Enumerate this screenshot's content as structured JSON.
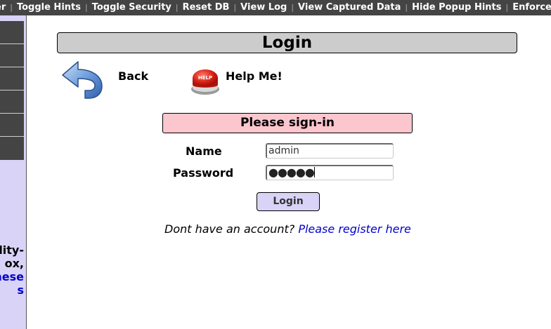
{
  "topbar": {
    "items": [
      "er",
      "Toggle Hints",
      "Toggle Security",
      "Reset DB",
      "View Log",
      "View Captured Data",
      "Hide Popup Hints",
      "Enforce SSL"
    ],
    "separator": "|"
  },
  "sidebar": {
    "blurb_line1": "lity-",
    "blurb_line2": "ox,",
    "blurb_link1": "hese",
    "blurb_link2": "s"
  },
  "page": {
    "title": "Login",
    "back_label": "Back",
    "help_label": "Help Me!",
    "help_badge": "HELP"
  },
  "form": {
    "header": "Please sign-in",
    "name_label": "Name",
    "name_value": "admin",
    "password_label": "Password",
    "password_mask": "●●●●●",
    "submit_label": "Login",
    "register_prompt": "Dont have an account?",
    "register_link": "Please register here"
  },
  "icons": {
    "back": "back-arrow-icon",
    "help": "help-button-icon"
  },
  "colors": {
    "topbar_bg": "#444444",
    "sidebar_bg": "#d8d3f7",
    "header_bg": "#cccccc",
    "signin_bg": "#fcc6ce",
    "button_bg": "#d8d3f7",
    "link": "#0000cc"
  }
}
